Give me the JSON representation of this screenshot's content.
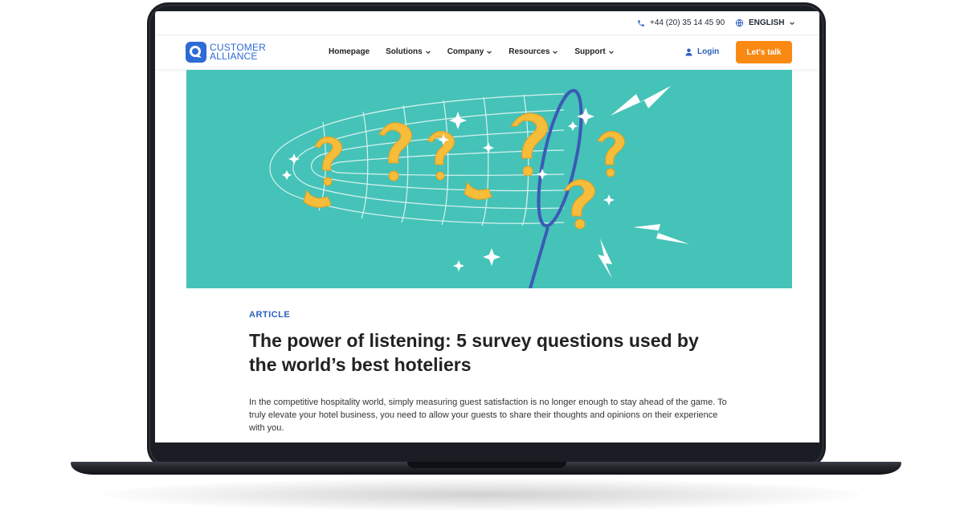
{
  "topbar": {
    "phone": "+44 (20) 35 14 45 90",
    "language": "ENGLISH"
  },
  "brand": {
    "logo_line1": "CUSTOMER",
    "logo_line2": "ALLIANCE"
  },
  "nav": {
    "items": [
      {
        "label": "Homepage",
        "has_dropdown": false
      },
      {
        "label": "Solutions",
        "has_dropdown": true
      },
      {
        "label": "Company",
        "has_dropdown": true
      },
      {
        "label": "Resources",
        "has_dropdown": true
      },
      {
        "label": "Support",
        "has_dropdown": true
      }
    ],
    "login": "Login",
    "cta": "Let's talk"
  },
  "hero": {
    "icon": "butterfly-net-catching-question-marks-illustration"
  },
  "article": {
    "kicker": "ARTICLE",
    "title": "The power of listening: 5 survey questions used by the world’s best hoteliers",
    "lead": "In the competitive hospitality world, simply measuring guest satisfaction is no longer enough to stay ahead of the game. To truly elevate your hotel business, you need to allow your guests to share their thoughts and opinions on their experience with you."
  },
  "colors": {
    "accent": "#2d5fbf",
    "cta": "#f98913",
    "hero_bg": "#45c3b8",
    "question_marks": "#f6bd3b"
  }
}
